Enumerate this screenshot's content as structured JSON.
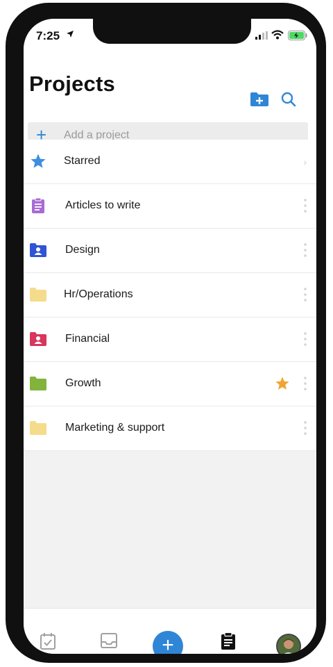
{
  "status_bar": {
    "time": "7:25"
  },
  "header": {
    "title": "Projects",
    "add_project_placeholder": "Add a project",
    "add_icon": "plus-icon",
    "new_folder_icon": "folder-plus-icon",
    "search_icon": "search-icon"
  },
  "projects": [
    {
      "label": "Starred",
      "icon": "star-icon",
      "color": "#3f8ee0",
      "trailing": "chevron"
    },
    {
      "label": "Articles to write",
      "icon": "clipboard-icon",
      "color": "#a86bd4",
      "trailing": "more"
    },
    {
      "label": "Design",
      "icon": "shared-folder-icon",
      "color": "#2f55d4",
      "trailing": "more"
    },
    {
      "label": "Hr/Operations",
      "icon": "folder-icon",
      "color": "#f5dc8c",
      "trailing": "more"
    },
    {
      "label": "Financial",
      "icon": "shared-folder-icon",
      "color": "#d8365c",
      "trailing": "more"
    },
    {
      "label": "Growth",
      "icon": "folder-icon",
      "color": "#82b33c",
      "trailing": "more",
      "starred": true
    },
    {
      "label": "Marketing & support",
      "icon": "folder-icon",
      "color": "#f5dc8c",
      "trailing": "more"
    }
  ],
  "tab_bar": {
    "tabs": [
      "calendar-icon",
      "inbox-icon",
      "add-icon",
      "projects-icon",
      "avatar"
    ],
    "active": "projects-icon",
    "accent": "#2f86d6"
  },
  "colors": {
    "accent": "#2f86d6",
    "star_favorite": "#f0a431"
  }
}
